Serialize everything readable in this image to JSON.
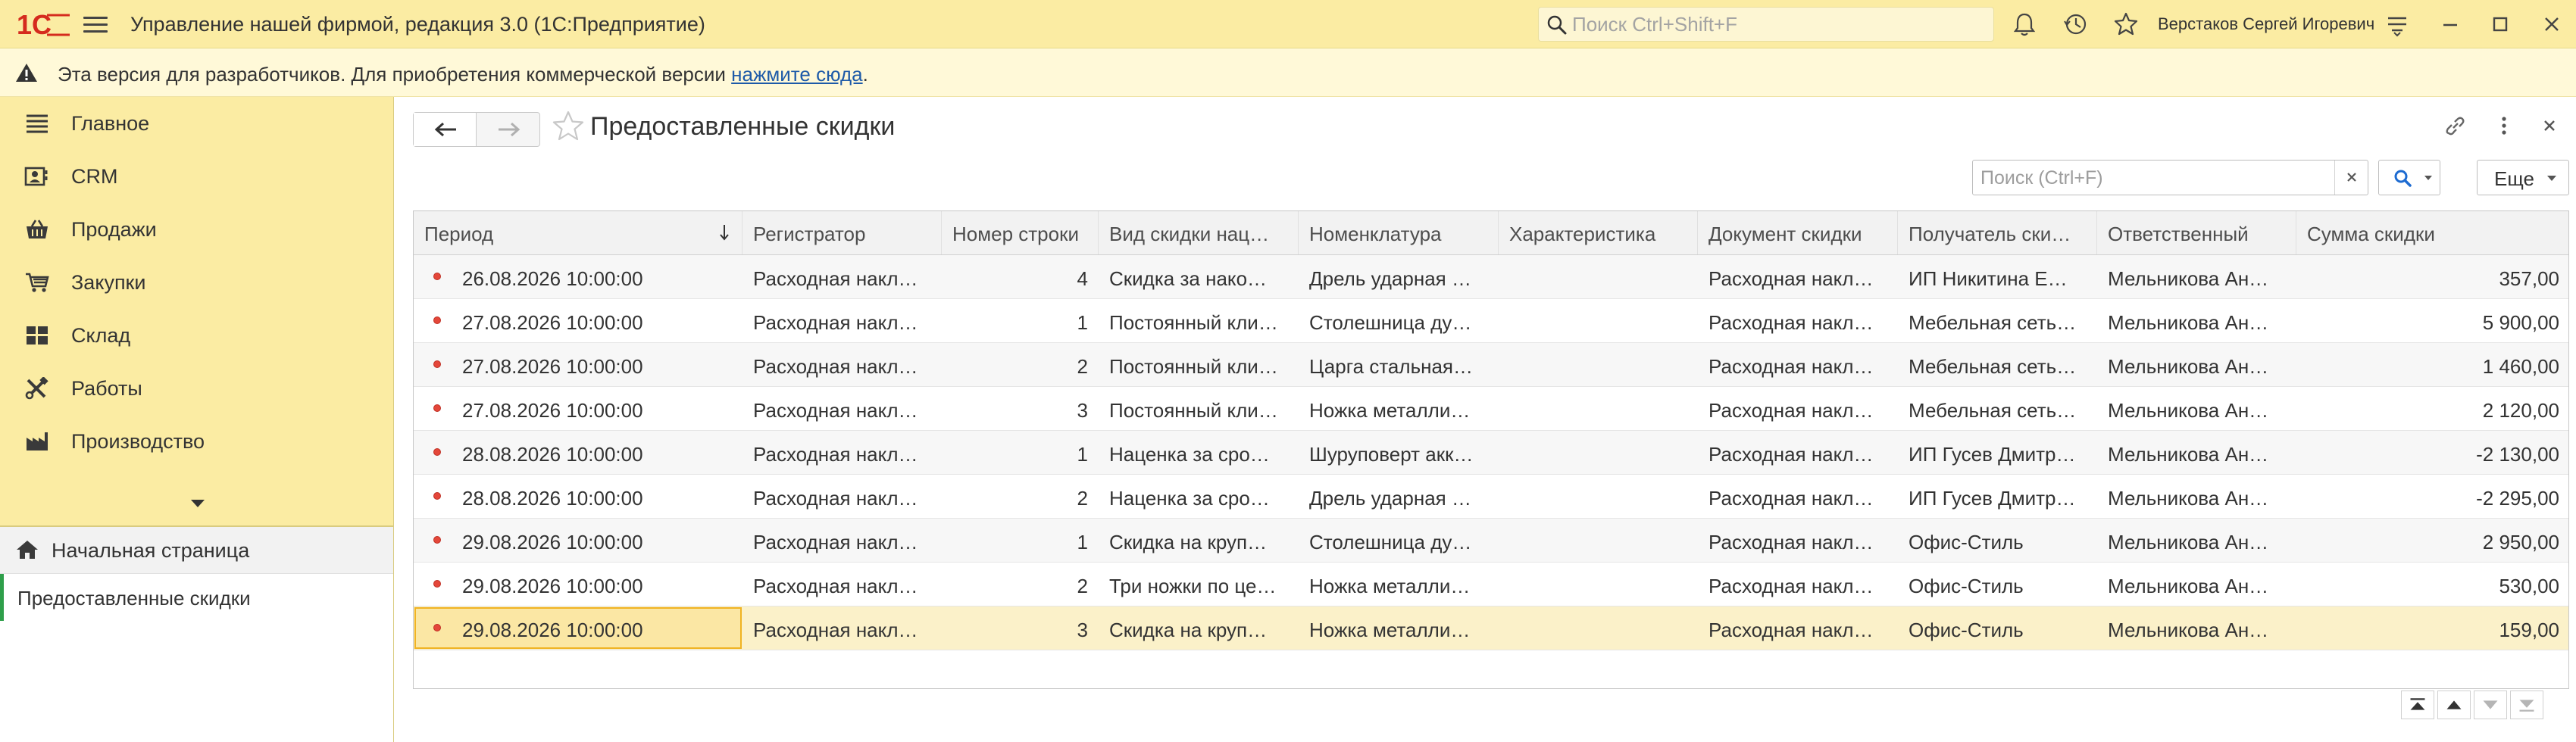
{
  "titlebar": {
    "logo_text": "1С",
    "app_title": "Управление нашей фирмой, редакция 3.0  (1С:Предприятие)",
    "search_placeholder": "Поиск Ctrl+Shift+F",
    "user_name": "Верстаков Сергей Игоревич",
    "icons": [
      "notifications-icon",
      "history-icon",
      "favorites-icon",
      "settings-icon",
      "minimize-icon",
      "maximize-icon",
      "close-icon"
    ]
  },
  "warning": {
    "text": "Эта версия для разработчиков. Для приобретения коммерческой версии ",
    "link_text": "нажмите сюда",
    "suffix": "."
  },
  "sidebar": {
    "items": [
      {
        "label": "Главное",
        "icon": "list-icon"
      },
      {
        "label": "CRM",
        "icon": "crm-icon"
      },
      {
        "label": "Продажи",
        "icon": "basket-icon"
      },
      {
        "label": "Закупки",
        "icon": "cart-icon"
      },
      {
        "label": "Склад",
        "icon": "warehouse-icon"
      },
      {
        "label": "Работы",
        "icon": "tools-icon"
      },
      {
        "label": "Производство",
        "icon": "factory-icon"
      }
    ],
    "home_label": "Начальная страница",
    "open_form_label": "Предоставленные скидки"
  },
  "form": {
    "title": "Предоставленные скидки",
    "search_placeholder": "Поиск (Ctrl+F)",
    "more_label": "Еще",
    "columns": [
      "Период",
      "Регистратор",
      "Номер строки",
      "Вид скидки нац…",
      "Номенклатура",
      "Характеристика",
      "Документ скидки",
      "Получатель ски…",
      "Ответственный",
      "Сумма скидки"
    ],
    "rows": [
      [
        "26.08.2026 10:00:00",
        "Расходная накл…",
        "4",
        "Скидка за нако…",
        "Дрель ударная …",
        "",
        "Расходная накл…",
        "ИП Никитина Е…",
        "Мельникова Ан…",
        "357,00"
      ],
      [
        "27.08.2026 10:00:00",
        "Расходная накл…",
        "1",
        "Постоянный кли…",
        "Столешница ду…",
        "",
        "Расходная накл…",
        "Мебельная сеть…",
        "Мельникова Ан…",
        "5 900,00"
      ],
      [
        "27.08.2026 10:00:00",
        "Расходная накл…",
        "2",
        "Постоянный кли…",
        "Царга стальная…",
        "",
        "Расходная накл…",
        "Мебельная сеть…",
        "Мельникова Ан…",
        "1 460,00"
      ],
      [
        "27.08.2026 10:00:00",
        "Расходная накл…",
        "3",
        "Постоянный кли…",
        "Ножка металли…",
        "",
        "Расходная накл…",
        "Мебельная сеть…",
        "Мельникова Ан…",
        "2 120,00"
      ],
      [
        "28.08.2026 10:00:00",
        "Расходная накл…",
        "1",
        "Наценка за сро…",
        "Шуруповерт акк…",
        "",
        "Расходная накл…",
        "ИП Гусев Дмитр…",
        "Мельникова Ан…",
        "-2 130,00"
      ],
      [
        "28.08.2026 10:00:00",
        "Расходная накл…",
        "2",
        "Наценка за сро…",
        "Дрель ударная …",
        "",
        "Расходная накл…",
        "ИП Гусев Дмитр…",
        "Мельникова Ан…",
        "-2 295,00"
      ],
      [
        "29.08.2026 10:00:00",
        "Расходная накл…",
        "1",
        "Скидка на круп…",
        "Столешница ду…",
        "",
        "Расходная накл…",
        "Офис-Стиль",
        "Мельникова Ан…",
        "2 950,00"
      ],
      [
        "29.08.2026 10:00:00",
        "Расходная накл…",
        "2",
        "Три ножки по це…",
        "Ножка металли…",
        "",
        "Расходная накл…",
        "Офис-Стиль",
        "Мельникова Ан…",
        "530,00"
      ],
      [
        "29.08.2026 10:00:00",
        "Расходная накл…",
        "3",
        "Скидка на круп…",
        "Ножка металли…",
        "",
        "Расходная накл…",
        "Офис-Стиль",
        "Мельникова Ан…",
        "159,00"
      ]
    ],
    "selected_row": 8
  },
  "colors": {
    "titlebar_bg": "#fbeca3",
    "warning_bg": "#fff9d8",
    "selected_row_bg": "#fbf1c9",
    "focus_border": "#f0b323",
    "brand_red": "#d52b1e",
    "link": "#1d5aa8"
  }
}
